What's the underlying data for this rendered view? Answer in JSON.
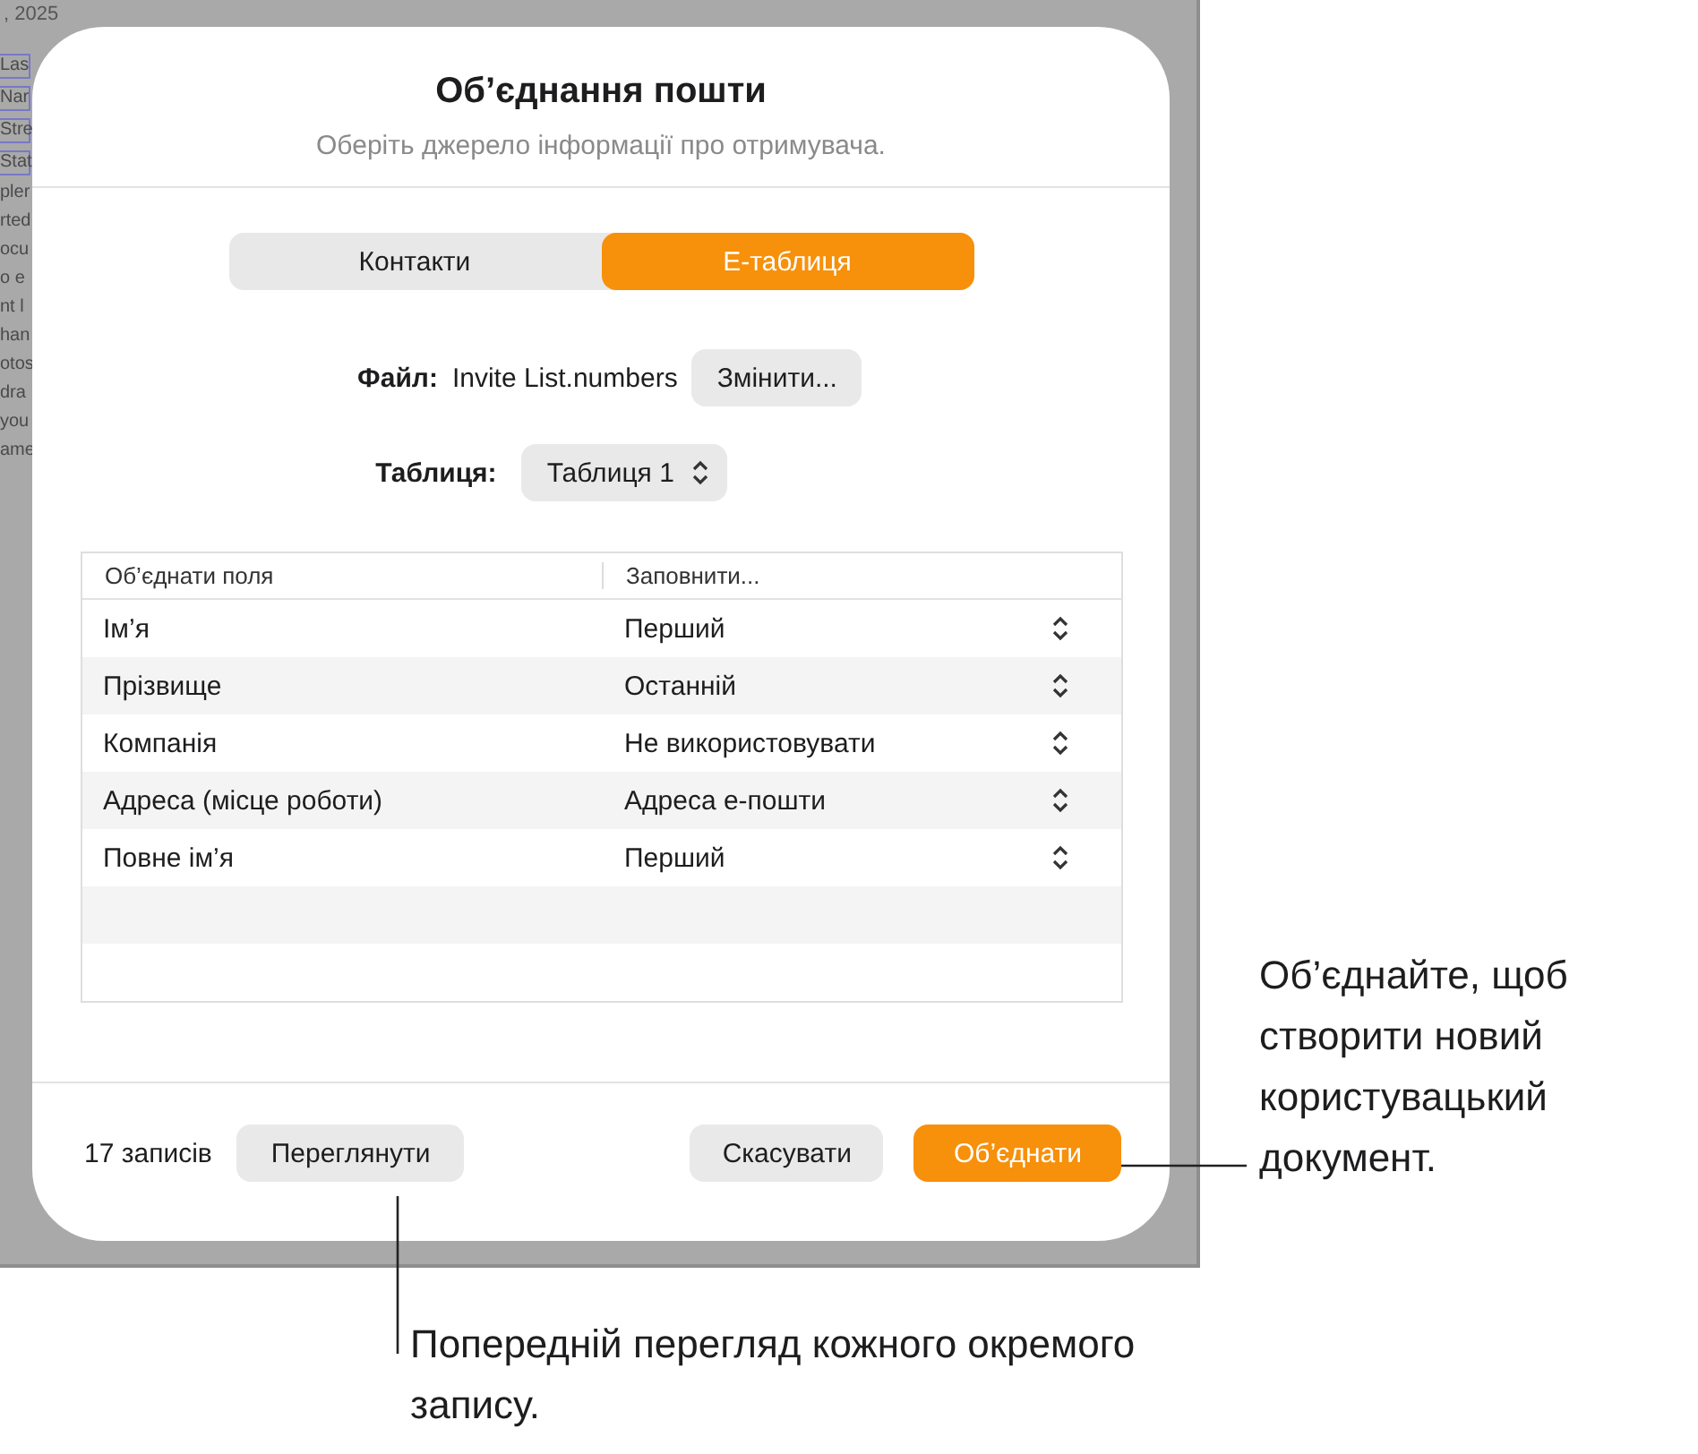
{
  "background_document": {
    "date": ", 2025",
    "fragments": [
      "Las",
      "Nar",
      "Stre",
      "Stat",
      "pler",
      "rted",
      "ocu",
      "o e",
      "nt l",
      "han",
      "otos",
      "dra",
      "you",
      "ame"
    ]
  },
  "dialog": {
    "title": "Об’єднання пошти",
    "subtitle": "Оберіть джерело інформації про отримувача.",
    "source_tabs": [
      {
        "label": "Контакти",
        "selected": false
      },
      {
        "label": "Е-таблиця",
        "selected": true
      }
    ],
    "file": {
      "label": "Файл:",
      "name": "Invite List.numbers",
      "button": "Змінити..."
    },
    "table_picker": {
      "label": "Таблиця:",
      "value": "Таблиця 1"
    },
    "fields_table": {
      "columns": [
        "Об’єднати поля",
        "Заповнити..."
      ],
      "rows": [
        {
          "field": "Ім’я",
          "fill": "Перший"
        },
        {
          "field": "Прізвище",
          "fill": "Останній"
        },
        {
          "field": "Компанія",
          "fill": "Не використовувати"
        },
        {
          "field": "Адреса (місце роботи)",
          "fill": "Адреса е-пошти"
        },
        {
          "field": "Повне ім’я",
          "fill": "Перший"
        }
      ]
    },
    "record_count": "17 записів",
    "buttons": [
      {
        "label": "Переглянути",
        "kind": "secondary"
      },
      {
        "label": "Скасувати",
        "kind": "secondary"
      },
      {
        "label": "Об’єднати",
        "kind": "primary"
      }
    ]
  },
  "callouts": [
    {
      "text": "Об’єднайте, щоб створити новий користувацький документ.",
      "kind": "right"
    },
    {
      "text": "Попередній перегляд кожного окремого запису.",
      "kind": "bottom"
    }
  ]
}
